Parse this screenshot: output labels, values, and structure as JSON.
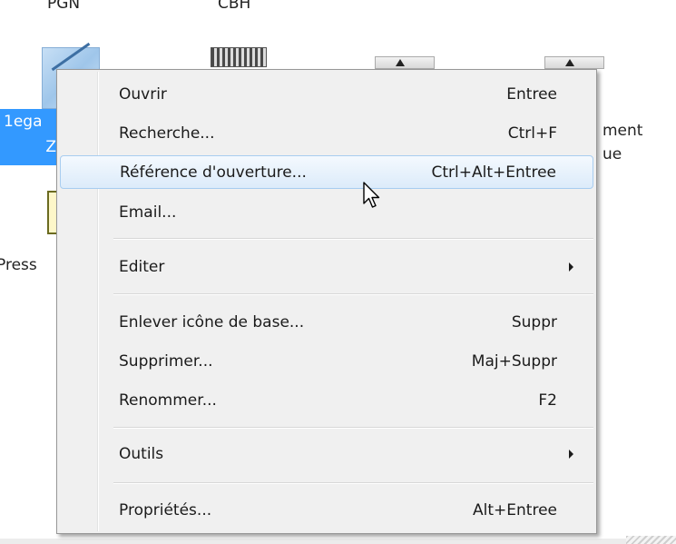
{
  "desktop": {
    "icons": [
      {
        "label": "PGN"
      },
      {
        "label": "CBH"
      }
    ],
    "selected_item": {
      "line1": "1ega",
      "line2": "Z"
    },
    "press_label": "Press",
    "right_label_1": "ment",
    "right_label_2": "ue"
  },
  "context_menu": {
    "items": [
      {
        "label": "Ouvrir",
        "shortcut": "Entree"
      },
      {
        "label": "Recherche...",
        "shortcut": "Ctrl+F"
      },
      {
        "label": "Référence d'ouverture...",
        "shortcut": "Ctrl+Alt+Entree",
        "highlighted": true
      },
      {
        "label": "Email...",
        "shortcut": ""
      },
      {
        "label": "Editer",
        "shortcut": "",
        "submenu": true
      },
      {
        "label": "Enlever icône de base...",
        "shortcut": "Suppr"
      },
      {
        "label": "Supprimer...",
        "shortcut": "Maj+Suppr"
      },
      {
        "label": "Renommer...",
        "shortcut": "F2"
      },
      {
        "label": "Outils",
        "shortcut": "",
        "submenu": true
      },
      {
        "label": "Propriétés...",
        "shortcut": "Alt+Entree"
      }
    ]
  },
  "colors": {
    "selection_blue": "#3399ff",
    "menu_background": "#f0f0f0",
    "menu_highlight_border": "#a8cdf0",
    "menu_highlight_fill": "#dcebfa"
  },
  "icons": {
    "submenu": "chevron-right-icon",
    "cursor": "arrow-cursor-icon"
  }
}
